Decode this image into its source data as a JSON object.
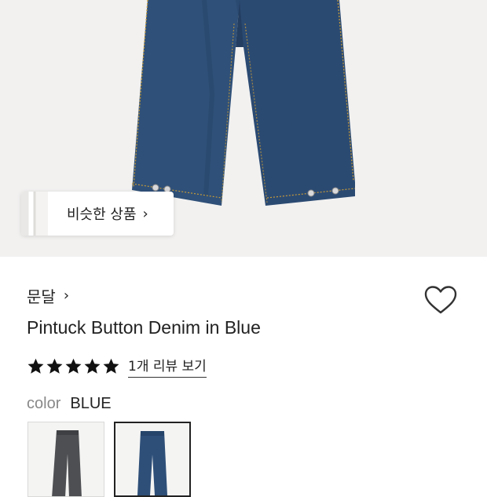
{
  "similar_products": {
    "label": "비슷한 상품",
    "chevron": "›"
  },
  "brand": {
    "name": "문달",
    "chevron": "›"
  },
  "product": {
    "title": "Pintuck Button Denim in Blue"
  },
  "rating": {
    "stars": 5,
    "review_link": "1개 리뷰 보기"
  },
  "color_option": {
    "label": "color",
    "selected_value": "BLUE"
  },
  "swatches": [
    {
      "name": "gray",
      "color": "#4d4f52"
    },
    {
      "name": "blue",
      "color": "#2e4f78",
      "selected": true
    }
  ],
  "colors": {
    "denim": "#2f5078",
    "denim_seam": "#c49a3a",
    "hero_background": "#f2f1f0",
    "star": "#111111"
  },
  "icons": {
    "heart": "heart-icon",
    "star": "star-icon",
    "chevron": "chevron-right-icon"
  }
}
